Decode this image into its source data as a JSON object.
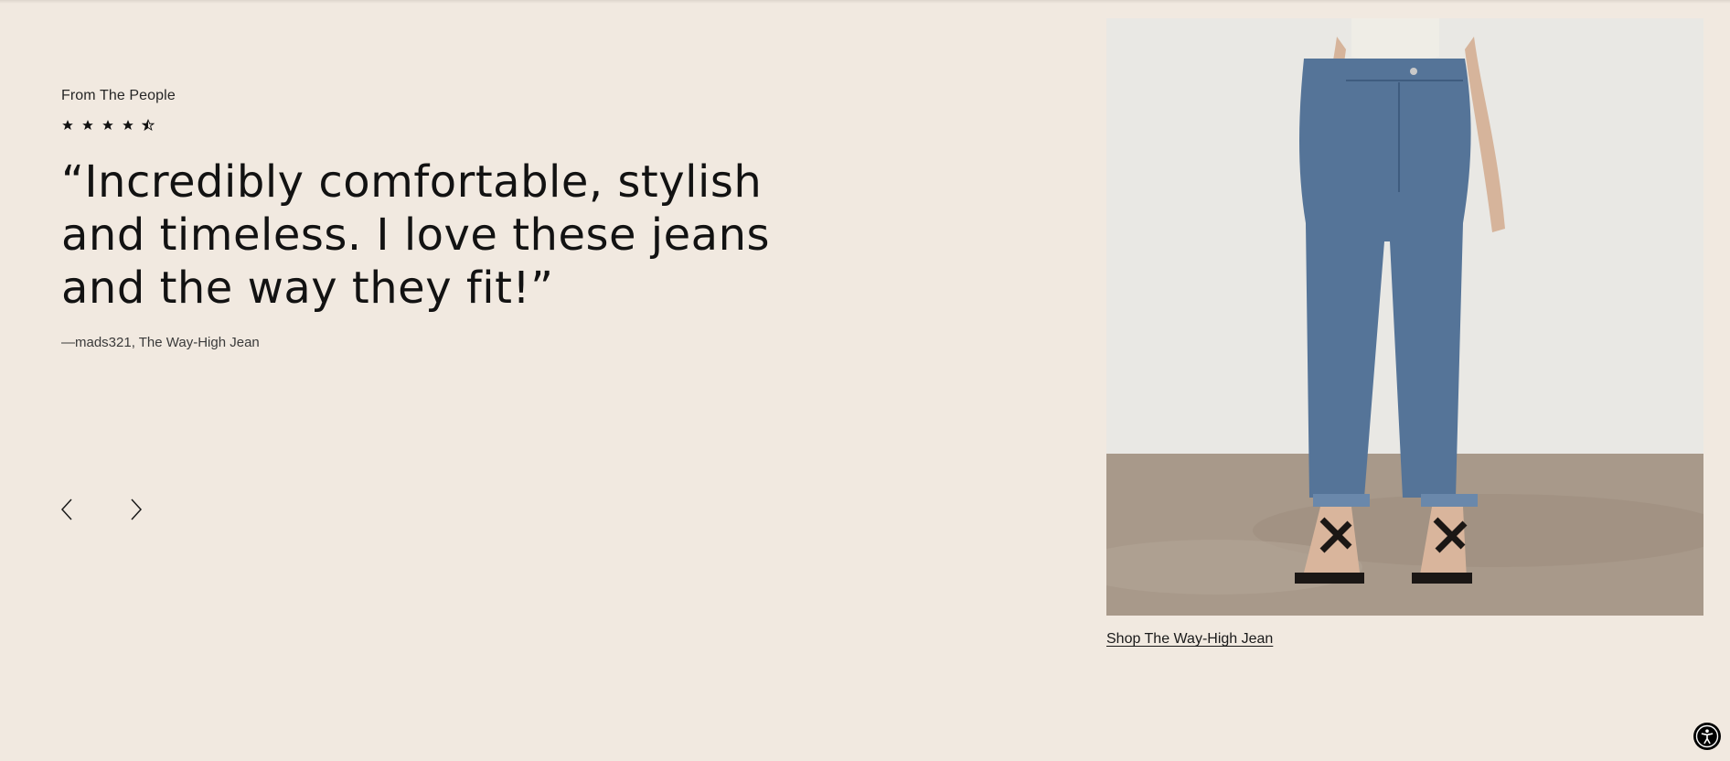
{
  "section": {
    "eyebrow": "From The People",
    "rating": 4.5,
    "rating_max": 5,
    "quote": "“Incredibly comfortable, stylish and timeless. I love these jeans and the way they fit!”",
    "attribution": "—mads321, The Way-High Jean"
  },
  "carousel": {
    "prev_icon": "chevron-left-icon",
    "next_icon": "chevron-right-icon"
  },
  "product": {
    "shop_label": "Shop The Way-High Jean"
  },
  "accessibility": {
    "icon": "accessibility-icon"
  },
  "colors": {
    "background": "#f1e9e0",
    "text": "#121212",
    "denim": "#4f6f93"
  }
}
